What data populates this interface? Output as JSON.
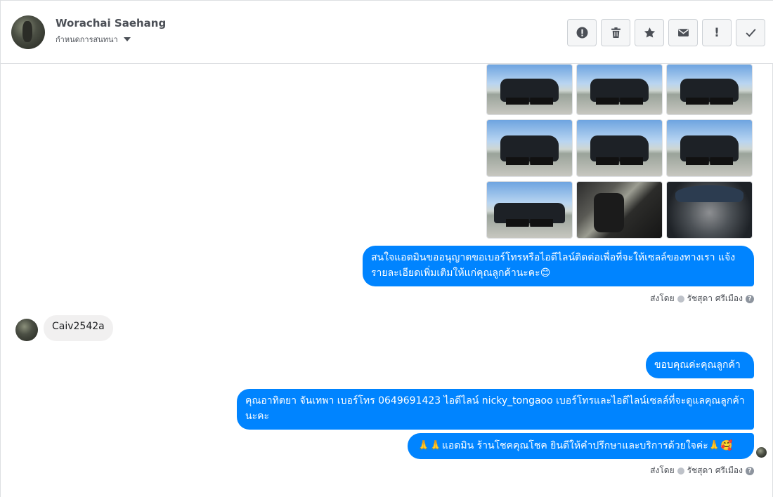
{
  "header": {
    "user_name": "Worachai Saehang",
    "assign_label": "กำหนดการสนทนา",
    "actions": [
      {
        "name": "report-spam-button",
        "icon": "alert-circle-icon"
      },
      {
        "name": "delete-button",
        "icon": "trash-icon"
      },
      {
        "name": "star-button",
        "icon": "star-icon"
      },
      {
        "name": "mark-unread-button",
        "icon": "envelope-icon"
      },
      {
        "name": "mark-important-button",
        "icon": "exclamation-icon"
      },
      {
        "name": "mark-done-button",
        "icon": "checkmark-icon"
      }
    ]
  },
  "messages": {
    "outgoing_1": "สนใจแอดมินขออนุญาตขอเบอร์โทรหรือไอดีไลน์ติดต่อเพื่อที่จะให้เซลล์ของทางเรา แจ้งรายละเอียดเพิ่มเติมให้แก่คุณลูกค้านะคะ😊",
    "incoming_1": "Caiv2542a",
    "outgoing_2": "ขอบคุณค่ะคุณลูกค้า",
    "outgoing_3": "คุณอาทิตยา จันเทพา      เบอร์โทร 0649691423  ไอดีไลน์ nicky_tongaoo   เบอร์โทรและไอดีไลน์เซลล์ที่จะดูแลคุณลูกค้านะคะ",
    "outgoing_4": "🙏🙏แอดมิน ร้านโชคคุณโชค ยินดีให้คำปรึกษาและบริการด้วยใจค่ะ🙏🥰",
    "sent_by_label": "ส่งโดย",
    "sent_by_name": "รัชสุดา ศรีเมือง",
    "help_glyph": "?"
  },
  "photos": [
    "exterior",
    "exterior",
    "exterior",
    "exterior",
    "exterior",
    "exterior",
    "side",
    "interior",
    "engine"
  ],
  "colors": {
    "accent": "#0084ff",
    "incoming_bubble": "#f1f0f0"
  }
}
